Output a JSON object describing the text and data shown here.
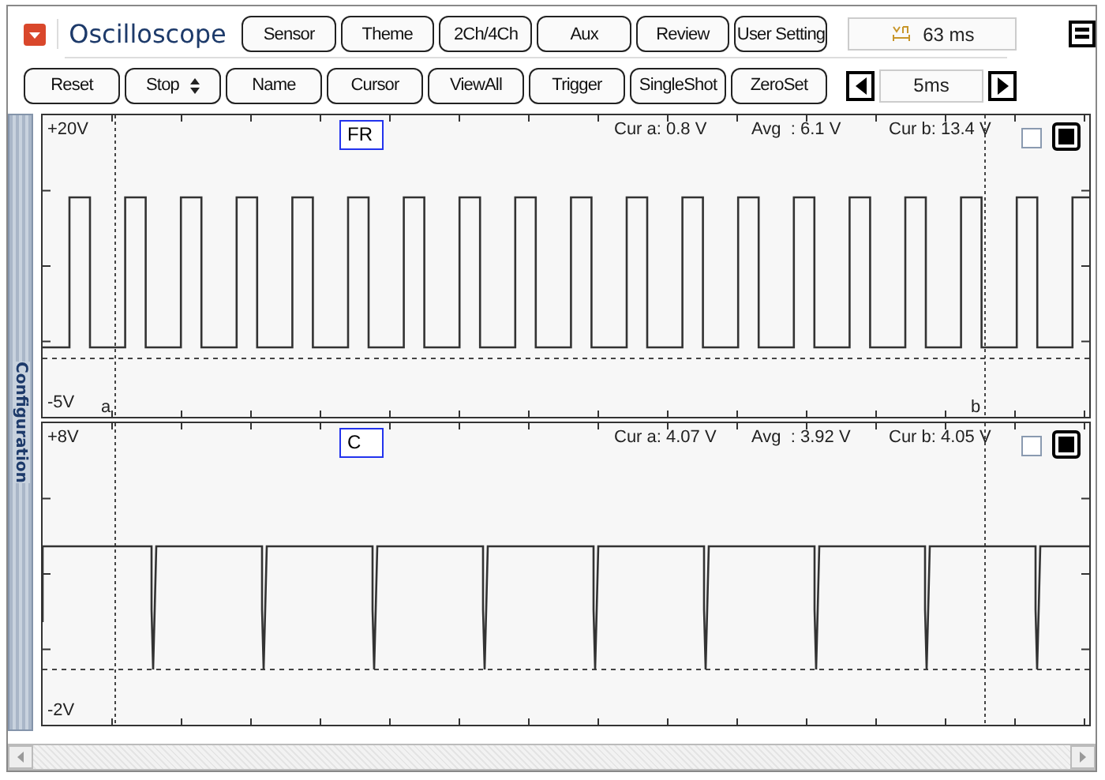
{
  "app": {
    "title": "Oscilloscope"
  },
  "menu_buttons": [
    "Sensor",
    "Theme",
    "2Ch/4Ch",
    "Aux",
    "Review",
    "User Setting"
  ],
  "delta_time": "63 ms",
  "toolbar": [
    {
      "kind": "button",
      "label": "Reset"
    },
    {
      "kind": "select",
      "label": "Stop"
    },
    {
      "kind": "button",
      "label": "Name"
    },
    {
      "kind": "button",
      "label": "Cursor"
    },
    {
      "kind": "button",
      "label": "ViewAll"
    },
    {
      "kind": "button",
      "label": "Trigger"
    },
    {
      "kind": "button",
      "label": "SingleShot"
    },
    {
      "kind": "button",
      "label": "ZeroSet"
    }
  ],
  "timebase": "5ms",
  "side_tab": "Configuration",
  "channels": [
    {
      "name": "FR",
      "top_label": "+20V",
      "bottom_label": "-5V",
      "cursor_a": "Cur a: 0.8 V",
      "avg": "Avg  : 6.1 V",
      "cursor_b": "Cur b: 13.4 V",
      "checked": false,
      "kind": "square",
      "cursor_a_label": "a",
      "cursor_b_label": "b"
    },
    {
      "name": "C",
      "top_label": "+8V",
      "bottom_label": "-2V",
      "cursor_a": "Cur a: 4.07 V",
      "avg": "Avg  : 3.92 V",
      "cursor_b": "Cur b: 4.05 V",
      "checked": false,
      "kind": "pulse"
    }
  ]
}
